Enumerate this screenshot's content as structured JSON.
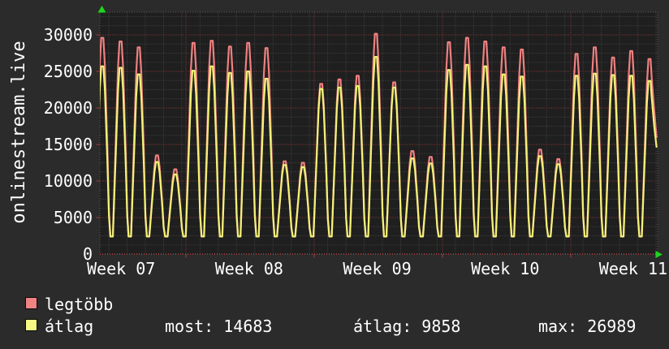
{
  "colors": {
    "background": "#2b2b2b",
    "plot_background": "#1f1f1f",
    "grid_minor": "#49494d",
    "grid_major": "#a83a3a",
    "baseline": "#b84444",
    "border": "#55555a",
    "text": "#ffffff",
    "arrow": "#1fd41f",
    "series_legtobb": "#f08080",
    "series_atlag": "#f2f277"
  },
  "y_axis_title": "onlinestream.live",
  "y_tick_labels": [
    "30000",
    "25000",
    "20000",
    "15000",
    "10000",
    "5000",
    "0"
  ],
  "week_labels": [
    "Week 07",
    "Week 08",
    "Week 09",
    "Week 10",
    "Week 11"
  ],
  "legend": [
    {
      "label": "legtöbb",
      "color": "#f18282"
    },
    {
      "label": "átlag",
      "color": "#f8f885"
    }
  ],
  "stats_row": [
    "most: 14683",
    "átlag: 9858",
    "max: 26989"
  ],
  "chart_data": {
    "type": "line",
    "title": "onlinestream.live",
    "x_axis": {
      "labels": [
        "Week 07",
        "Week 08",
        "Week 09",
        "Week 10",
        "Week 11"
      ],
      "unit": "days",
      "days_shown": 31
    },
    "y_axis": {
      "label": "",
      "ticks": [
        0,
        5000,
        10000,
        15000,
        20000,
        25000,
        30000
      ],
      "minor_step": 1250,
      "range": [
        0,
        33100
      ]
    },
    "grid": {
      "major_color": "#a83a3a",
      "minor_color": "#49494d",
      "style": "dotted"
    },
    "legend_position": "bottom-left",
    "series": [
      {
        "name": "legtöbb",
        "color": "#f08080",
        "trough": 2400,
        "end_value": 16000,
        "daily_peaks": [
          29600,
          29100,
          28300,
          13500,
          11600,
          28900,
          29200,
          28400,
          28900,
          28200,
          12700,
          12500,
          23300,
          23900,
          24400,
          30150,
          23500,
          14100,
          13300,
          29000,
          29600,
          29100,
          28300,
          28000,
          14300,
          13000,
          27400,
          28300,
          26900,
          27800,
          26700
        ]
      },
      {
        "name": "átlag",
        "color": "#f2f277",
        "trough": 2400,
        "end_value": 14683,
        "daily_peaks": [
          25700,
          25500,
          24600,
          12600,
          10900,
          25100,
          25700,
          24800,
          25000,
          24000,
          12200,
          11900,
          22600,
          22800,
          23000,
          26989,
          22800,
          13100,
          12400,
          25200,
          25900,
          25700,
          24600,
          24300,
          13400,
          12300,
          24400,
          24700,
          24500,
          24400,
          23700
        ]
      }
    ],
    "stats": {
      "most": 14683,
      "atlag": 9858,
      "max": 26989
    }
  }
}
